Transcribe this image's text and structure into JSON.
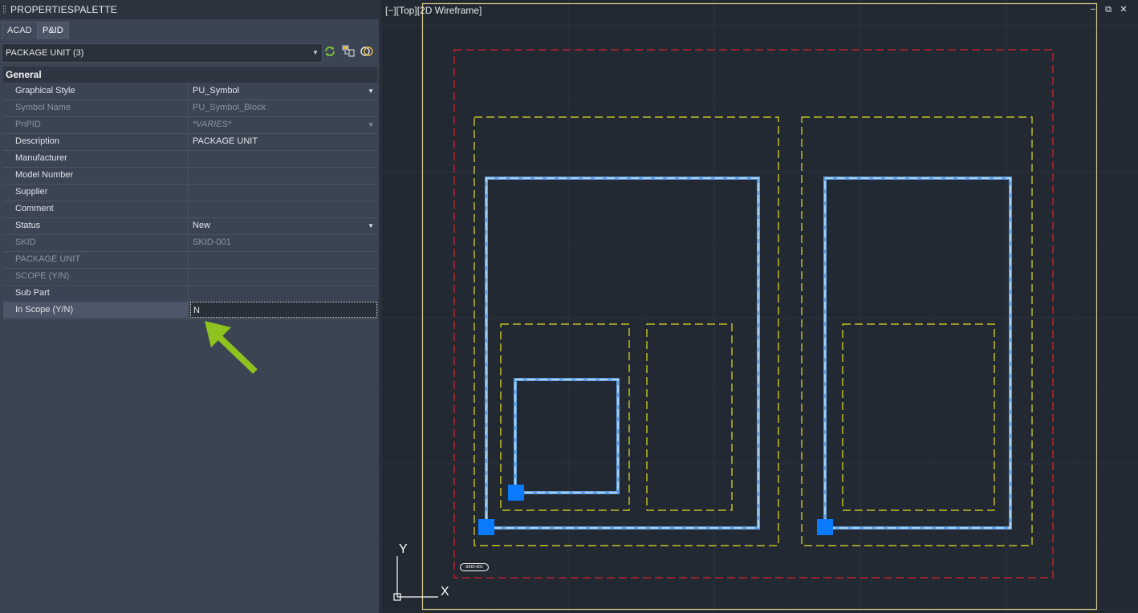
{
  "palette": {
    "title": "PROPERTIESPALETTE",
    "tabs": [
      "ACAD",
      "P&ID"
    ],
    "selection": "PACKAGE UNIT (3)",
    "section": "General",
    "rows": [
      {
        "name": "Graphical Style",
        "value": "PU_Symbol",
        "dropdown": true,
        "disabled": false
      },
      {
        "name": "Symbol Name",
        "value": "PU_Symbol_Block",
        "dropdown": false,
        "disabled": true
      },
      {
        "name": "PnPID",
        "value": "*VARIES*",
        "dropdown": true,
        "disabled": true
      },
      {
        "name": "Description",
        "value": "PACKAGE UNIT",
        "dropdown": false,
        "disabled": false
      },
      {
        "name": "Manufacturer",
        "value": "",
        "dropdown": false,
        "disabled": false
      },
      {
        "name": "Model Number",
        "value": "",
        "dropdown": false,
        "disabled": false
      },
      {
        "name": "Supplier",
        "value": "",
        "dropdown": false,
        "disabled": false
      },
      {
        "name": "Comment",
        "value": "",
        "dropdown": false,
        "disabled": false
      },
      {
        "name": "Status",
        "value": "New",
        "dropdown": true,
        "disabled": false
      },
      {
        "name": "SKID",
        "value": "SKID-001",
        "dropdown": false,
        "disabled": true
      },
      {
        "name": "PACKAGE UNIT",
        "value": "",
        "dropdown": false,
        "disabled": true
      },
      {
        "name": "SCOPE (Y/N)",
        "value": "",
        "dropdown": false,
        "disabled": true
      },
      {
        "name": "Sub Part",
        "value": "",
        "dropdown": false,
        "disabled": false
      },
      {
        "name": "In Scope (Y/N)",
        "value": "N",
        "dropdown": false,
        "disabled": false
      }
    ]
  },
  "viewport": {
    "label": "[−][Top][2D Wireframe]",
    "minimize": "−",
    "restore": "⧉",
    "close": "✕",
    "skid_tag": "SKID-001",
    "ucs_y": "Y",
    "ucs_x": "X"
  },
  "colors": {
    "red_boundary": "#d8262b",
    "yellow_boundary": "#e6e020",
    "blue_outline": "#5f9fe0",
    "grip": "#0a7aff",
    "arrow": "#8dc21f"
  }
}
